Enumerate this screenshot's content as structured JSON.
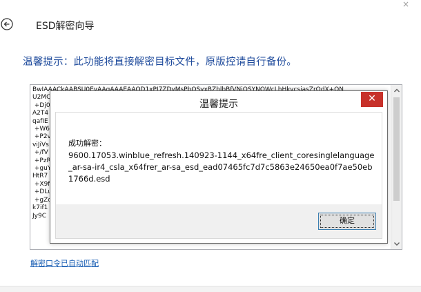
{
  "window": {
    "close_glyph": "×",
    "title": "ESD解密向导"
  },
  "warning": "温馨提示：此功能将直接解密目标文件，原版控请自行备份。",
  "key_lines": [
    "BwIAAACkAABSU0EyAAgAAAEAAQD1xPI7ZDvMsPbOSvxBZhlbBfVNiQSYNOWcLhHkycsiasZrOdX+ON",
    "U2MC",
    " +Dj0",
    "A2T4",
    "qafIE",
    " +W6",
    " +P2v",
    "viJiVs",
    " +/fV",
    " +PzR",
    " +guY",
    "HtR7",
    " +X9f",
    " +DLu",
    " +gZc",
    "k7if1",
    "Jy9C"
  ],
  "link_text": "解密口令已自动匹配",
  "dialog": {
    "title": "温馨提示",
    "close_glyph": "✕",
    "label": "成功解密：",
    "message": "9600.17053.winblue_refresh.140923-1144_x64fre_client_coresinglelanguage_ar-sa-ir4_csla_x64frer_ar-sa_esd_ead07465fc7d7c5863e24650ea0f7ae50eb1766d.esd",
    "ok_label": "确定"
  },
  "colors": {
    "warning_text": "#1f4b9c",
    "link": "#1a5fb4",
    "close_button": "#c7312a"
  },
  "icons": {
    "back": "back-arrow-icon",
    "close": "close-icon",
    "scroll_up": "chevron-up-icon",
    "scroll_down": "chevron-down-icon"
  }
}
